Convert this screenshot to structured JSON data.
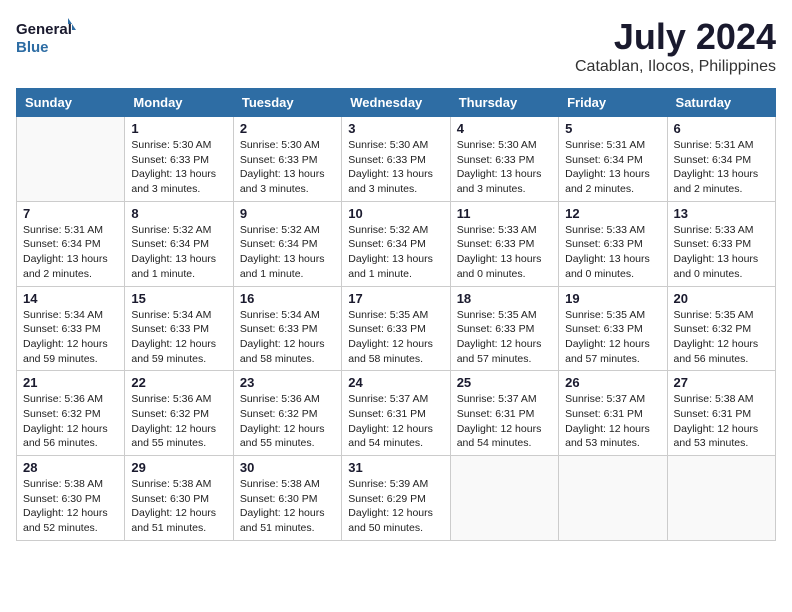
{
  "header": {
    "logo_line1": "General",
    "logo_line2": "Blue",
    "month_year": "July 2024",
    "location": "Catablan, Ilocos, Philippines"
  },
  "days_of_week": [
    "Sunday",
    "Monday",
    "Tuesday",
    "Wednesday",
    "Thursday",
    "Friday",
    "Saturday"
  ],
  "weeks": [
    [
      {
        "num": "",
        "info": ""
      },
      {
        "num": "1",
        "info": "Sunrise: 5:30 AM\nSunset: 6:33 PM\nDaylight: 13 hours\nand 3 minutes."
      },
      {
        "num": "2",
        "info": "Sunrise: 5:30 AM\nSunset: 6:33 PM\nDaylight: 13 hours\nand 3 minutes."
      },
      {
        "num": "3",
        "info": "Sunrise: 5:30 AM\nSunset: 6:33 PM\nDaylight: 13 hours\nand 3 minutes."
      },
      {
        "num": "4",
        "info": "Sunrise: 5:30 AM\nSunset: 6:33 PM\nDaylight: 13 hours\nand 3 minutes."
      },
      {
        "num": "5",
        "info": "Sunrise: 5:31 AM\nSunset: 6:34 PM\nDaylight: 13 hours\nand 2 minutes."
      },
      {
        "num": "6",
        "info": "Sunrise: 5:31 AM\nSunset: 6:34 PM\nDaylight: 13 hours\nand 2 minutes."
      }
    ],
    [
      {
        "num": "7",
        "info": "Sunrise: 5:31 AM\nSunset: 6:34 PM\nDaylight: 13 hours\nand 2 minutes."
      },
      {
        "num": "8",
        "info": "Sunrise: 5:32 AM\nSunset: 6:34 PM\nDaylight: 13 hours\nand 1 minute."
      },
      {
        "num": "9",
        "info": "Sunrise: 5:32 AM\nSunset: 6:34 PM\nDaylight: 13 hours\nand 1 minute."
      },
      {
        "num": "10",
        "info": "Sunrise: 5:32 AM\nSunset: 6:34 PM\nDaylight: 13 hours\nand 1 minute."
      },
      {
        "num": "11",
        "info": "Sunrise: 5:33 AM\nSunset: 6:33 PM\nDaylight: 13 hours\nand 0 minutes."
      },
      {
        "num": "12",
        "info": "Sunrise: 5:33 AM\nSunset: 6:33 PM\nDaylight: 13 hours\nand 0 minutes."
      },
      {
        "num": "13",
        "info": "Sunrise: 5:33 AM\nSunset: 6:33 PM\nDaylight: 13 hours\nand 0 minutes."
      }
    ],
    [
      {
        "num": "14",
        "info": "Sunrise: 5:34 AM\nSunset: 6:33 PM\nDaylight: 12 hours\nand 59 minutes."
      },
      {
        "num": "15",
        "info": "Sunrise: 5:34 AM\nSunset: 6:33 PM\nDaylight: 12 hours\nand 59 minutes."
      },
      {
        "num": "16",
        "info": "Sunrise: 5:34 AM\nSunset: 6:33 PM\nDaylight: 12 hours\nand 58 minutes."
      },
      {
        "num": "17",
        "info": "Sunrise: 5:35 AM\nSunset: 6:33 PM\nDaylight: 12 hours\nand 58 minutes."
      },
      {
        "num": "18",
        "info": "Sunrise: 5:35 AM\nSunset: 6:33 PM\nDaylight: 12 hours\nand 57 minutes."
      },
      {
        "num": "19",
        "info": "Sunrise: 5:35 AM\nSunset: 6:33 PM\nDaylight: 12 hours\nand 57 minutes."
      },
      {
        "num": "20",
        "info": "Sunrise: 5:35 AM\nSunset: 6:32 PM\nDaylight: 12 hours\nand 56 minutes."
      }
    ],
    [
      {
        "num": "21",
        "info": "Sunrise: 5:36 AM\nSunset: 6:32 PM\nDaylight: 12 hours\nand 56 minutes."
      },
      {
        "num": "22",
        "info": "Sunrise: 5:36 AM\nSunset: 6:32 PM\nDaylight: 12 hours\nand 55 minutes."
      },
      {
        "num": "23",
        "info": "Sunrise: 5:36 AM\nSunset: 6:32 PM\nDaylight: 12 hours\nand 55 minutes."
      },
      {
        "num": "24",
        "info": "Sunrise: 5:37 AM\nSunset: 6:31 PM\nDaylight: 12 hours\nand 54 minutes."
      },
      {
        "num": "25",
        "info": "Sunrise: 5:37 AM\nSunset: 6:31 PM\nDaylight: 12 hours\nand 54 minutes."
      },
      {
        "num": "26",
        "info": "Sunrise: 5:37 AM\nSunset: 6:31 PM\nDaylight: 12 hours\nand 53 minutes."
      },
      {
        "num": "27",
        "info": "Sunrise: 5:38 AM\nSunset: 6:31 PM\nDaylight: 12 hours\nand 53 minutes."
      }
    ],
    [
      {
        "num": "28",
        "info": "Sunrise: 5:38 AM\nSunset: 6:30 PM\nDaylight: 12 hours\nand 52 minutes."
      },
      {
        "num": "29",
        "info": "Sunrise: 5:38 AM\nSunset: 6:30 PM\nDaylight: 12 hours\nand 51 minutes."
      },
      {
        "num": "30",
        "info": "Sunrise: 5:38 AM\nSunset: 6:30 PM\nDaylight: 12 hours\nand 51 minutes."
      },
      {
        "num": "31",
        "info": "Sunrise: 5:39 AM\nSunset: 6:29 PM\nDaylight: 12 hours\nand 50 minutes."
      },
      {
        "num": "",
        "info": ""
      },
      {
        "num": "",
        "info": ""
      },
      {
        "num": "",
        "info": ""
      }
    ]
  ]
}
